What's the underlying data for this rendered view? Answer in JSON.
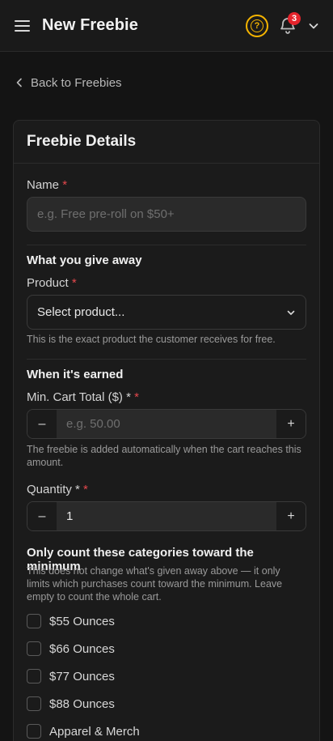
{
  "header": {
    "title": "New Freebie",
    "help_glyph": "?",
    "notification_count": "3",
    "accent": "#f5b400",
    "badge_color": "#e5242c"
  },
  "nav": {
    "back_label": "Back to Freebies"
  },
  "card": {
    "title": "Freebie Details",
    "name_field": {
      "label": "Name",
      "required_mark": "*",
      "value": "",
      "placeholder": "e.g. Free pre-roll on $50+"
    },
    "give_away": {
      "heading": "What you give away",
      "product_label": "Product",
      "required_mark": "*",
      "product_value": "Select product...",
      "helper": "This is the exact product the customer receives for free."
    },
    "earned": {
      "heading": "When it's earned",
      "min_cart_label": "Min. Cart Total ($) *",
      "min_cart_required": "*",
      "min_cart_placeholder": "e.g. 50.00",
      "min_cart_value": "",
      "min_cart_helper": "The freebie is added automatically when the cart reaches this amount.",
      "quantity_label": "Quantity *",
      "quantity_required": "*",
      "quantity_value": "1",
      "minus": "–",
      "plus": "+"
    },
    "categories": {
      "heading": "Only count these categories toward the minimum",
      "helper": "This does not change what's given away above — it only limits which purchases count toward the minimum. Leave empty to count the whole cart.",
      "items": [
        {
          "label": "$55 Ounces",
          "checked": false
        },
        {
          "label": "$66 Ounces",
          "checked": false
        },
        {
          "label": "$77 Ounces",
          "checked": false
        },
        {
          "label": "$88 Ounces",
          "checked": false
        },
        {
          "label": "Apparel & Merch",
          "checked": false
        }
      ]
    }
  }
}
